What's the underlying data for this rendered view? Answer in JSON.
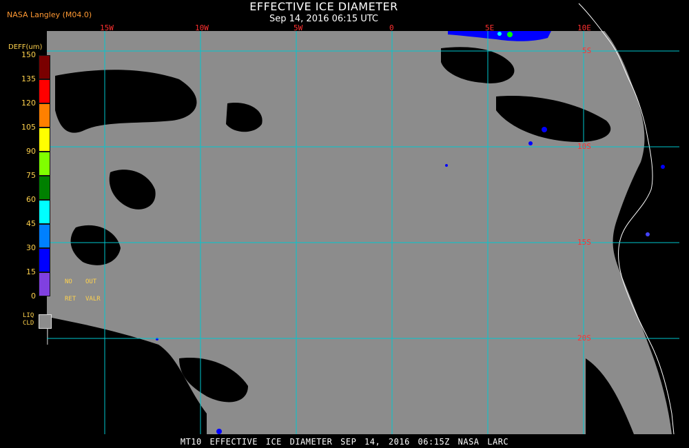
{
  "header": {
    "producer": "NASA Langley (M04.0)",
    "title": "EFFECTIVE ICE DIAMETER",
    "subtitle": "Sep 14, 2016 06:15 UTC"
  },
  "legend": {
    "title": "DEFF(um)",
    "ticks": [
      "150",
      "135",
      "120",
      "105",
      "90",
      "75",
      "60",
      "45",
      "30",
      "15",
      "0"
    ],
    "colors": [
      "#7a0000",
      "#ff0000",
      "#ff8000",
      "#ffff00",
      "#80ff00",
      "#008000",
      "#00ffff",
      "#0080ff",
      "#0000ff",
      "#8040e0"
    ],
    "no_ret_label_1": "NO",
    "no_ret_label_2": "RET",
    "out_valr_label_1": "OUT",
    "out_valr_label_2": "VALR",
    "liq_label_1": "LIQ",
    "liq_label_2": "CLD",
    "liq_color": "#8c8c8c"
  },
  "map": {
    "longitude_labels": [
      "15W",
      "10W",
      "5W",
      "0",
      "5E",
      "10E"
    ],
    "latitude_labels": [
      "5S",
      "10S",
      "15S",
      "20S"
    ],
    "grid_color": "#00c8d0",
    "land_color": "#000000",
    "liquid_cloud_color": "#8c8c8c",
    "coast_color": "#ffffff"
  },
  "footer": {
    "text": "MT10  EFFECTIVE ICE DIAMETER   SEP 14, 2016 06:15Z   NASA LARC"
  }
}
